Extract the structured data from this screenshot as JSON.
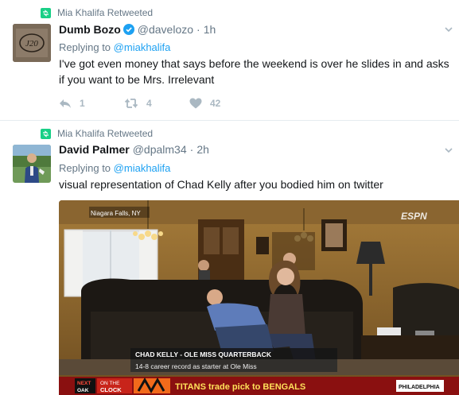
{
  "tweets": [
    {
      "retweeted_by": "Mia Khalifa Retweeted",
      "display_name": "Dumb Bozo",
      "handle": "@davelozo",
      "separator": "·",
      "time": "1h",
      "verified": true,
      "replying_prefix": "Replying to",
      "replying_to": "@miakhalifa",
      "text": "I've got even money that says before the weekend is over he slides in and asks if you want to be Mrs. Irrelevant",
      "reply_count": "1",
      "retweet_count": "4",
      "like_count": "42",
      "avatar_text": "J20"
    },
    {
      "retweeted_by": "Mia Khalifa Retweeted",
      "display_name": "David Palmer",
      "handle": "@dpalm34",
      "separator": "·",
      "time": "2h",
      "replying_prefix": "Replying to",
      "replying_to": "@miakhalifa",
      "text": "visual representation of Chad Kelly after you bodied him on twitter",
      "media": {
        "location_tag": "Niagara Falls, NY",
        "network_logo": "ESPN",
        "lower_third_line1": "CHAD KELLY - OLE MISS QUARTERBACK",
        "lower_third_line2": "14-8 career record as starter at Ole Miss",
        "ticker_next_top": "NEXT",
        "ticker_next_bottom": "OAK",
        "ticker_clock_top": "ON THE",
        "ticker_clock_bottom": "CLOCK",
        "ticker_headline": "TITANS trade pick to BENGALS",
        "ticker_right": "PHILADELPHIA"
      }
    }
  ],
  "colors": {
    "retweet_green": "#19cf86",
    "link_blue": "#1da1f2",
    "muted_gray": "#657786",
    "action_gray": "#aab8c2",
    "verified_blue": "#1da1f2"
  },
  "icons": [
    "retweet-icon",
    "verified-badge-icon",
    "chevron-down-icon",
    "reply-icon",
    "like-icon"
  ]
}
